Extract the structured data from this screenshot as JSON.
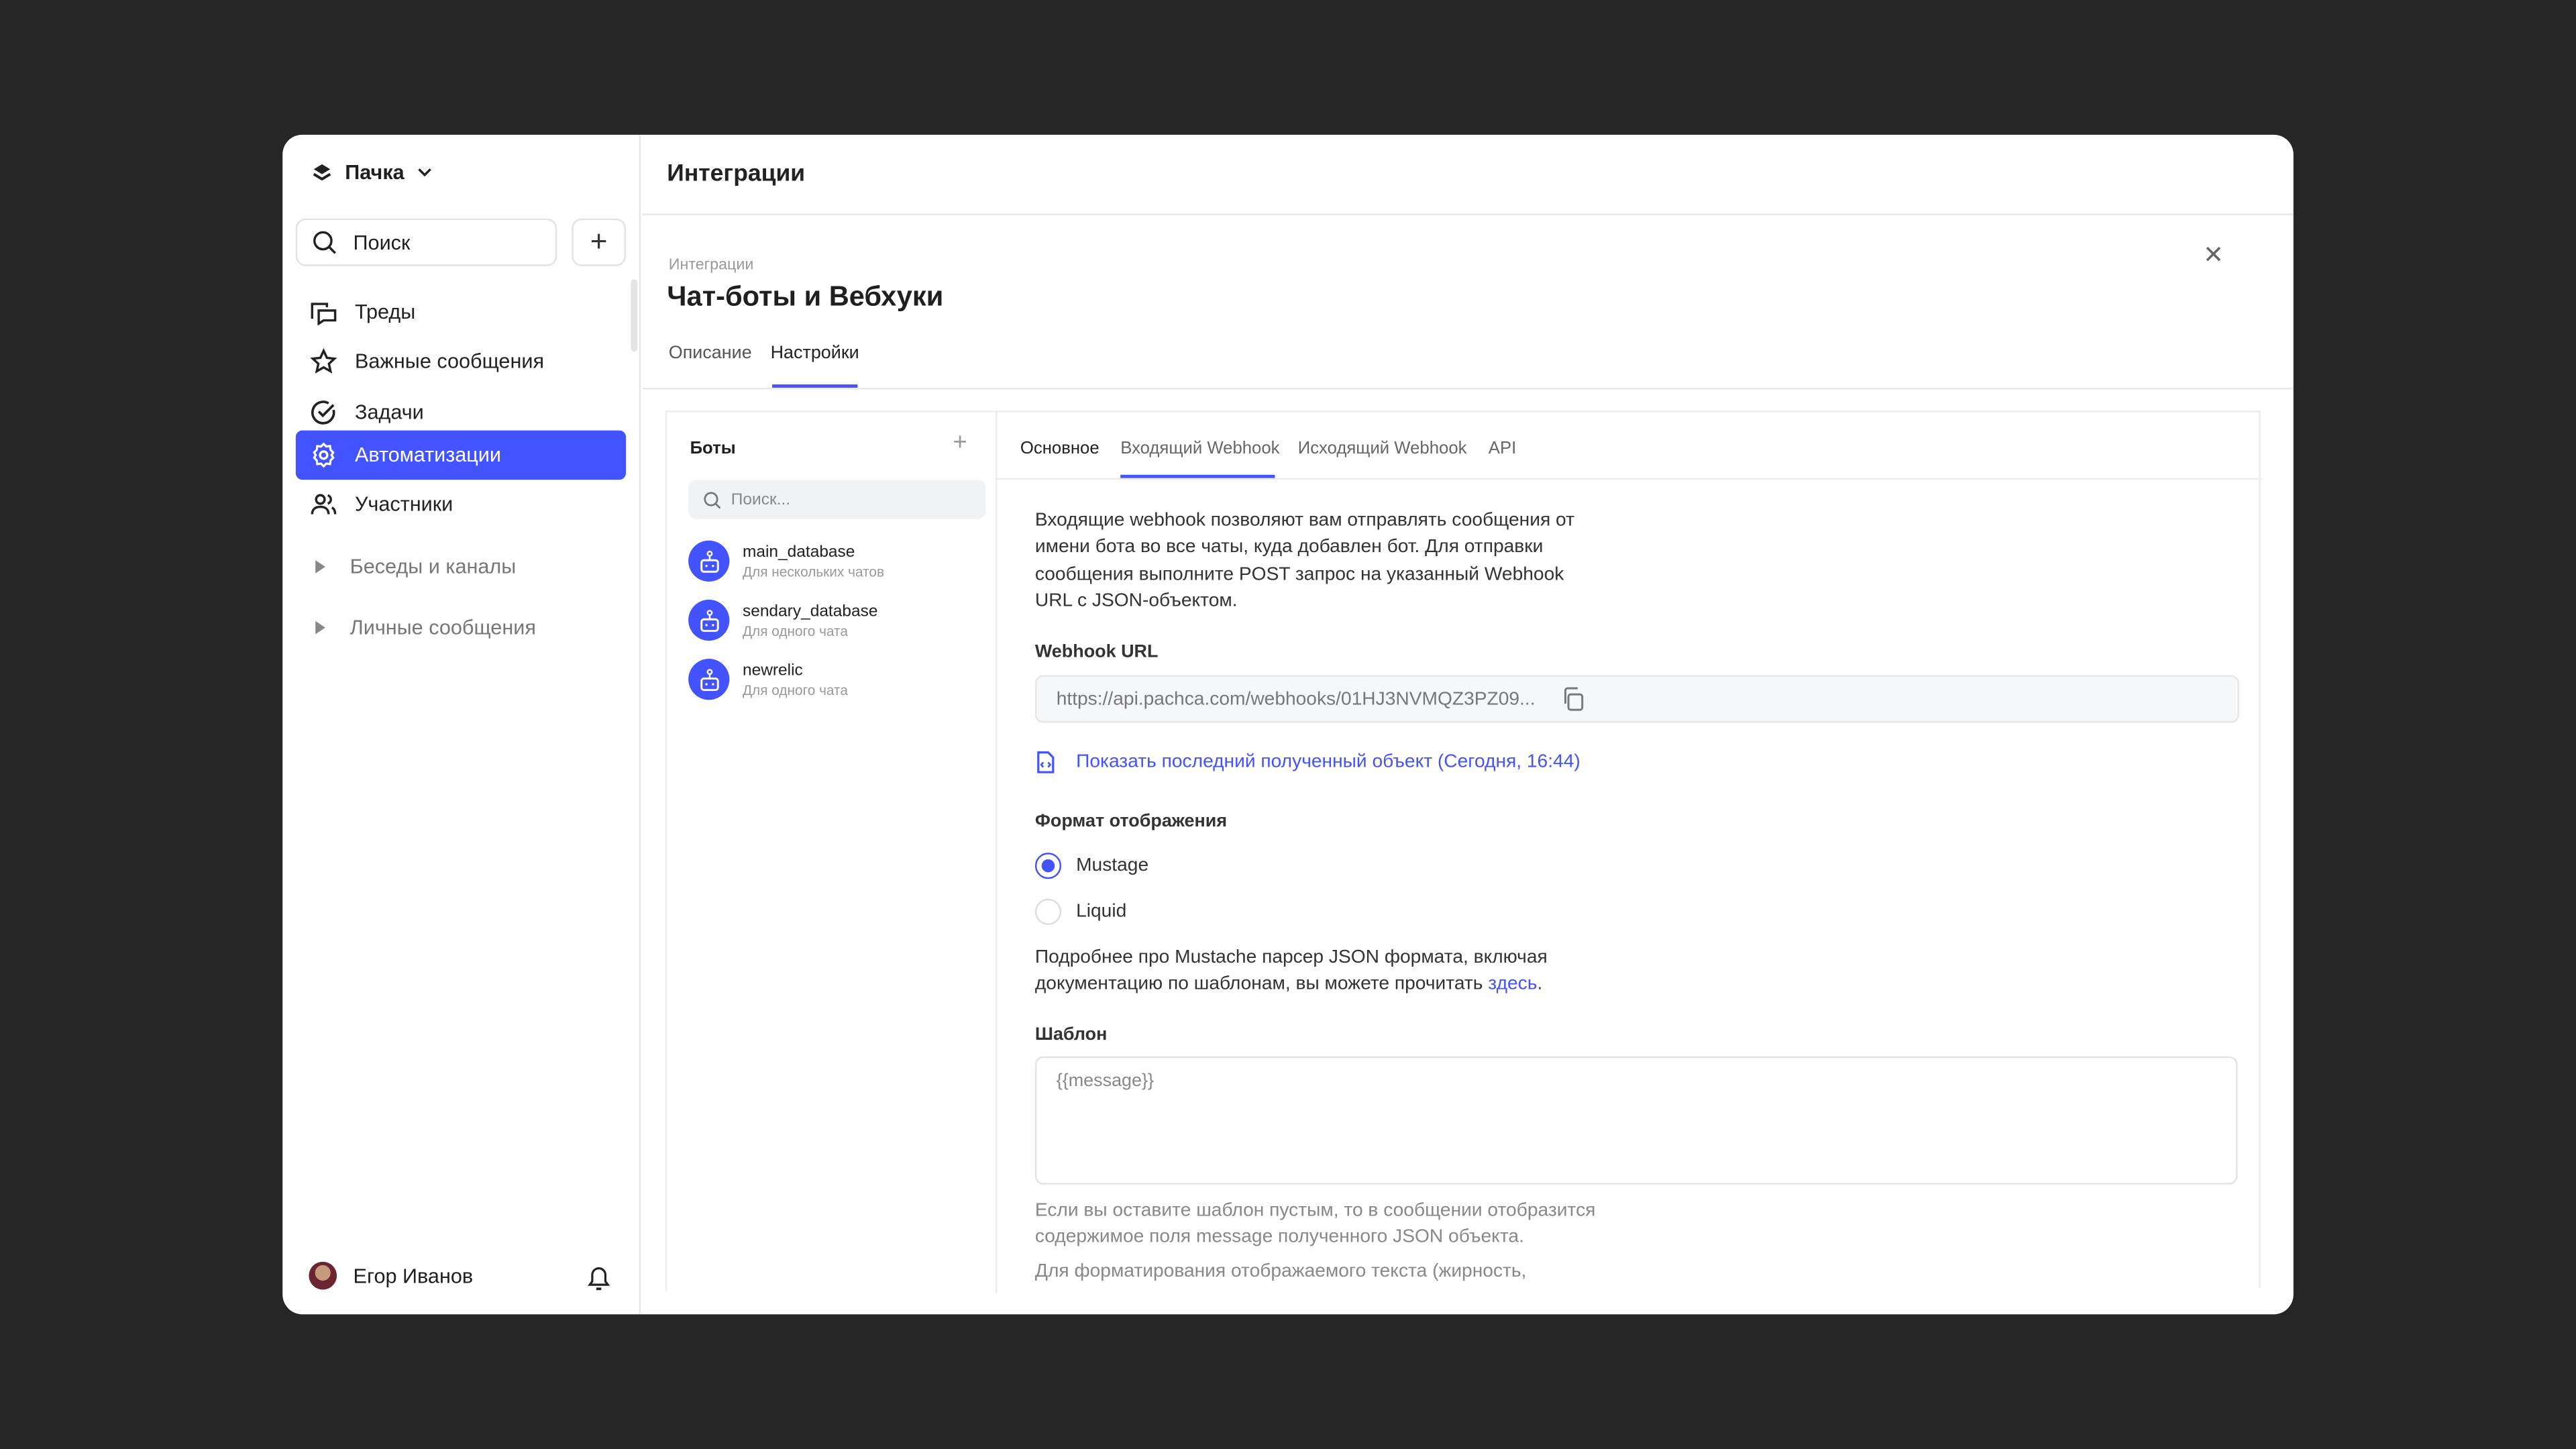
{
  "workspace": {
    "name": "Пачка"
  },
  "sidebar": {
    "search_placeholder": "Поиск",
    "items": [
      {
        "label": "Треды",
        "icon": "threads-icon"
      },
      {
        "label": "Важные сообщения",
        "icon": "star-icon"
      },
      {
        "label": "Задачи",
        "icon": "check-circle-icon"
      },
      {
        "label": "Автоматизации",
        "icon": "gear-icon",
        "active": true
      },
      {
        "label": "Участники",
        "icon": "users-icon"
      }
    ],
    "groups": [
      {
        "label": "Беседы и каналы"
      },
      {
        "label": "Личные сообщения"
      }
    ],
    "user": {
      "name": "Егор Иванов"
    }
  },
  "header": {
    "title": "Интеграции"
  },
  "page": {
    "breadcrumb": "Интеграции",
    "title": "Чат-боты и Вебхуки",
    "tabs": [
      {
        "label": "Описание"
      },
      {
        "label": "Настройки",
        "active": true
      }
    ]
  },
  "bots": {
    "title": "Боты",
    "search_placeholder": "Поиск...",
    "items": [
      {
        "name": "main_database",
        "sub": "Для нескольких чатов"
      },
      {
        "name": "sendary_database",
        "sub": "Для одного чата"
      },
      {
        "name": "newrelic",
        "sub": "Для одного чата"
      }
    ]
  },
  "detail": {
    "tabs": [
      {
        "label": "Основное"
      },
      {
        "label": "Входящий Webhook",
        "active": true
      },
      {
        "label": "Исходящий Webhook"
      },
      {
        "label": "API"
      }
    ],
    "intro": [
      "Входящие webhook позволяют вам отправлять сообщения от",
      "имени бота во все чаты, куда добавлен бот. Для отправки",
      "сообщения выполните POST запрос на указанный Webhook",
      "URL с JSON-объектом."
    ],
    "url_label": "Webhook URL",
    "url_value": "https://api.pachca.com/webhooks/01HJ3NVMQZ3PZ09...",
    "last_object_link": "Показать последний полученный объект (Сегодня, 16:44)",
    "format_label": "Формат отображения",
    "formats": [
      {
        "label": "Mustage",
        "selected": true
      },
      {
        "label": "Liquid",
        "selected": false
      }
    ],
    "more_line1": "Подробнее про Mustache парсер JSON формата, включая",
    "more_line2": "документацию по шаблонам, вы можете прочитать ",
    "more_link": "здесь",
    "more_end": ".",
    "template_label": "Шаблон",
    "template_placeholder": "{{message}}",
    "help": [
      "Если вы оставите шаблон пустым, то в сообщении отобразится",
      "содержимое поля message полученного JSON объекта."
    ],
    "help2": "Для форматирования отображаемого текста (жирность,"
  },
  "colors": {
    "accent": "#4353ff",
    "background": "#262626"
  }
}
